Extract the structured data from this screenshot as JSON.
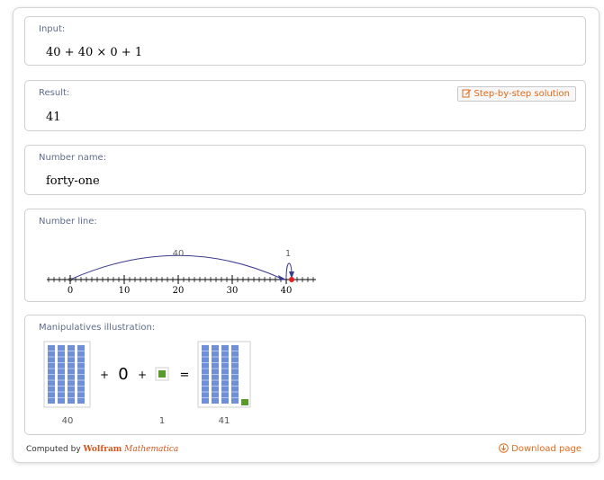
{
  "input_pod": {
    "title": "Input:",
    "expression": "40 + 40 × 0 + 1"
  },
  "result_pod": {
    "title": "Result:",
    "value": "41",
    "step_button_label": "Step-by-step solution"
  },
  "name_pod": {
    "title": "Number name:",
    "value": "forty-one"
  },
  "numberline_pod": {
    "title": "Number line:",
    "ticks": [
      "0",
      "10",
      "20",
      "30",
      "40"
    ],
    "arc_labels": [
      "40",
      "1"
    ]
  },
  "manip_pod": {
    "title": "Manipulatives illustration:",
    "plus1": "+",
    "zero": "0",
    "plus2": "+",
    "equals": "=",
    "label_40": "40",
    "label_1": "1",
    "label_41": "41"
  },
  "footer": {
    "computed_by": "Computed by",
    "wolfram": "Wolfram",
    "mathematica": "Mathematica",
    "download": "Download page"
  },
  "colors": {
    "accent": "#e26a1a",
    "rod_blue": "#6f8fd6",
    "unit_green": "#5b9a2a",
    "arc": "#3b3b8f",
    "marker": "#e02020"
  }
}
